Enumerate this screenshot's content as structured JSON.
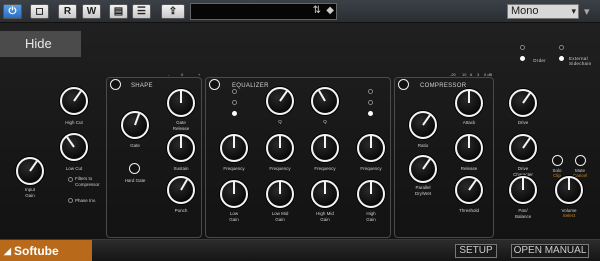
{
  "host": {
    "buttons": [
      "R",
      "W"
    ],
    "channel_mode": "Mono"
  },
  "plugin": {
    "hide_label": "Hide",
    "sections": {
      "shape": "SHAPE",
      "equalizer": "EQUALIZER",
      "compressor": "COMPRESSOR"
    },
    "order": {
      "label": "Order",
      "external_sidechain": "External Sidechain"
    },
    "gr_scale": [
      "-20",
      "10",
      "6",
      "3",
      "0 dB"
    ],
    "shape_scale": [
      "-",
      "0",
      "+"
    ],
    "input": {
      "knob": "Input Gain"
    },
    "filters": {
      "high_cut": "High Cut",
      "low_cut": "Low Cut",
      "filters_to_compressor": "Filters to Compressor",
      "phase_inv": "Phase Inv."
    },
    "shape": {
      "gate": "Gate",
      "hard_gate": "Hard Gate",
      "gate_release": "Gate Release",
      "sustain": "Sustain",
      "punch": "Punch"
    },
    "eq": {
      "q_label": "Q",
      "frequency": "Frequency",
      "low_gain": "Low Gain",
      "low_mid_gain": "Low Mid Gain",
      "high_mid_gain": "High Mid Gain",
      "high_gain": "High Gain"
    },
    "comp": {
      "ratio": "Ratio",
      "attack": "Attack",
      "parallel": "Parallel Dry/Wet",
      "release": "Release",
      "threshold": "Threshold"
    },
    "output": {
      "drive": "Drive",
      "drive_character": "Drive Character",
      "solo": "Solo",
      "solo_sub": "Clip",
      "mute": "Mute",
      "mute_sub": "Cancel",
      "pan": "Pan/ Balance",
      "volume": "Volume",
      "volume_sub": "Select"
    }
  },
  "footer": {
    "brand": "Softube",
    "setup": "SETUP",
    "open_manual": "OPEN MANUAL"
  },
  "colors": {
    "accent": "#b86a1a",
    "panel_bg": "#1a1a1a"
  }
}
